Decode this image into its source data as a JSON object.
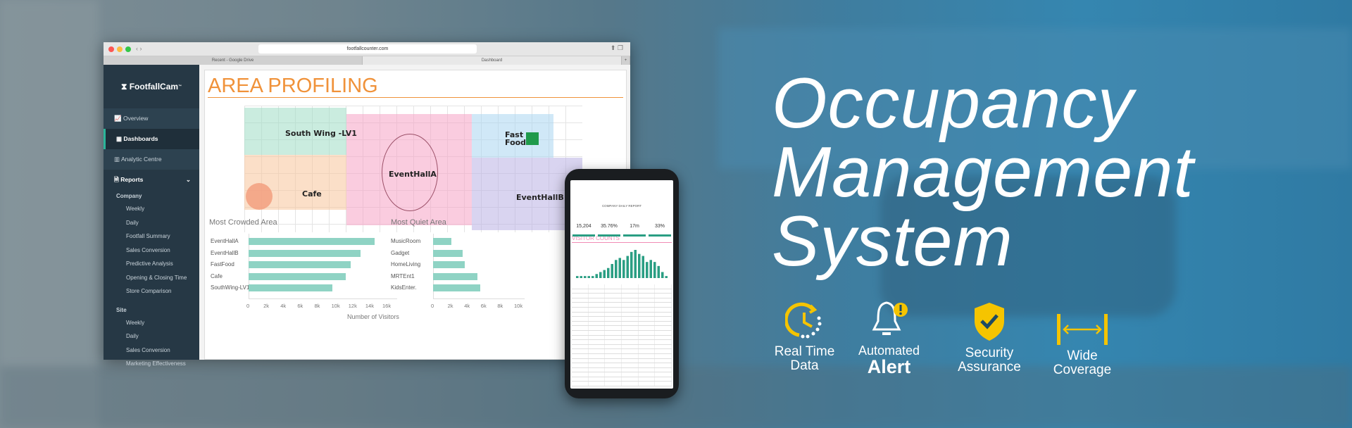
{
  "browser": {
    "url": "footfallcounter.com",
    "tabs": [
      "Recent - Google Drive",
      "Dashboard"
    ],
    "new_tab": "+"
  },
  "sidebar": {
    "logo": "FootfallCam",
    "logo_tm": "™",
    "nav": [
      {
        "label": "Overview",
        "icon": "chart-line-icon"
      },
      {
        "label": "Dashboards",
        "icon": "grid-icon",
        "active": true
      },
      {
        "label": "Analytic Centre",
        "icon": "bar-chart-icon"
      },
      {
        "label": "Reports",
        "icon": "document-icon"
      }
    ],
    "company_label": "Company",
    "company": [
      "Weekly",
      "Daily",
      "Footfall Summary",
      "Sales Conversion",
      "Predictive Analysis",
      "Opening & Closing Time",
      "Store Comparison"
    ],
    "site_label": "Site",
    "site": [
      "Weekly",
      "Daily",
      "Sales Conversion",
      "Marketing Effectiveness"
    ]
  },
  "page": {
    "title": "AREA PROFILING",
    "zones": {
      "south": "South Wing -LV1",
      "cafe": "Cafe",
      "hallA": "EventHallA",
      "fast": "Fast Food",
      "hallB": "EventHallB"
    },
    "zone_colors": {
      "south": "#9fdcc4",
      "cafe": "#f8c59b",
      "hallA": "#f5a3c4",
      "fast": "#a9d5f0",
      "hallB": "#b9b0e3"
    }
  },
  "chart_data": [
    {
      "type": "bar",
      "orientation": "horizontal",
      "title": "Most Crowded Area",
      "xlabel": "Number of Visitors",
      "categories": [
        "EventHallA",
        "EventHallB",
        "FastFood",
        "Cafe",
        "SouthWing-LV1"
      ],
      "values": [
        14800,
        13200,
        12000,
        11400,
        9900
      ],
      "xticks": [
        "0",
        "2k",
        "4k",
        "6k",
        "8k",
        "10k",
        "12k",
        "14k",
        "16k"
      ],
      "xlim": [
        0,
        17500
      ],
      "color": "#8fd3c4"
    },
    {
      "type": "bar",
      "orientation": "horizontal",
      "title": "Most Quiet Area",
      "categories": [
        "MusicRoom",
        "Gadget",
        "HomeLiving",
        "MRTEnt1",
        "KidsEnter."
      ],
      "values": [
        2200,
        3600,
        3800,
        5300,
        5700
      ],
      "xticks": [
        "0",
        "2k",
        "4k",
        "6k",
        "8k",
        "10k"
      ],
      "xlim": [
        0,
        11000
      ],
      "color": "#8fd3c4"
    }
  ],
  "phone": {
    "report_title": "COMPANY DAILY REPORT",
    "kpis": [
      "15,204",
      "35.76%",
      "17m",
      "33%"
    ],
    "section": "VISITOR COUNTS",
    "hourly": [
      1,
      1,
      1,
      1,
      1,
      2,
      3,
      4,
      5,
      7,
      9,
      10,
      9,
      11,
      13,
      14,
      12,
      11,
      8,
      9,
      8,
      6,
      3,
      1
    ]
  },
  "hero": {
    "line1": "Occupancy",
    "line2": "Management",
    "line3": "System"
  },
  "features": [
    {
      "icon": "real-time-clock-icon",
      "line1": "Real Time",
      "line2": "Data"
    },
    {
      "icon": "alert-bell-icon",
      "line1": "Automated",
      "line2": "Alert"
    },
    {
      "icon": "security-shield-icon",
      "line1": "Security",
      "line2": "Assurance"
    },
    {
      "icon": "wide-coverage-icon",
      "line1": "Wide",
      "line2": "Coverage"
    }
  ],
  "colors": {
    "accent": "#f0923a",
    "feature_icon": "#f5c400",
    "sidebar": "#263845",
    "bar": "#8fd3c4"
  }
}
